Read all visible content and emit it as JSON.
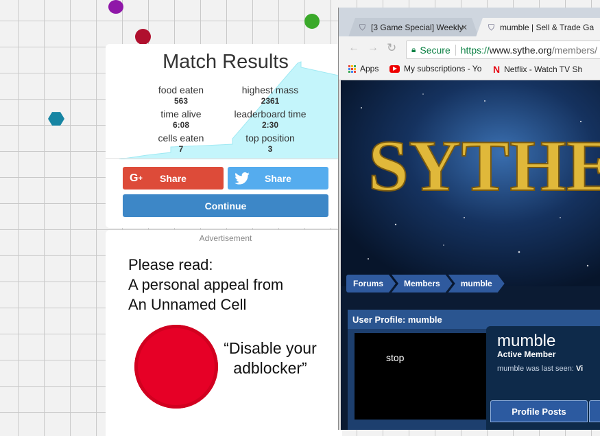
{
  "match_results": {
    "title": "Match Results",
    "stats": [
      {
        "label": "food eaten",
        "value": "563"
      },
      {
        "label": "highest mass",
        "value": "2361"
      },
      {
        "label": "time alive",
        "value": "6:08"
      },
      {
        "label": "leaderboard time",
        "value": "2:30"
      },
      {
        "label": "cells eaten",
        "value": "7"
      },
      {
        "label": "top position",
        "value": "3"
      }
    ],
    "share_google_label": "Share",
    "share_twitter_label": "Share",
    "continue_label": "Continue",
    "colors": {
      "google": "#dd4b39",
      "twitter": "#55acee",
      "continue": "#3d87c7",
      "graph_fill": "#c4f5fb"
    }
  },
  "ad": {
    "label": "Advertisement",
    "line1": "Please read:",
    "line2": "A personal appeal from",
    "line3": "An Unnamed Cell",
    "quote1": "“Disable your",
    "quote2": "adblocker”",
    "cell_color": "#e60026"
  },
  "browser": {
    "tab1_title": "[3 Game Special] Weekly",
    "tab2_title": "mumble | Sell & Trade Ga",
    "secure_label": "Secure",
    "url_scheme": "https://",
    "url_host": "www.sythe.org",
    "url_path": "/members/",
    "bookmarks": {
      "apps": "Apps",
      "subs": "My subscriptions - Yo",
      "netflix": "Netflix - Watch TV Sh"
    },
    "page": {
      "logo_text": "SYTHE",
      "breadcrumbs": [
        "Forums",
        "Members",
        "mumble"
      ],
      "profile_header": "User Profile: mumble",
      "avatar_text": "stop",
      "username": "mumble",
      "rank": "Active Member",
      "last_seen_label": "mumble was last seen:",
      "last_seen_value": "Vi",
      "profile_posts_tab": "Profile Posts"
    }
  }
}
